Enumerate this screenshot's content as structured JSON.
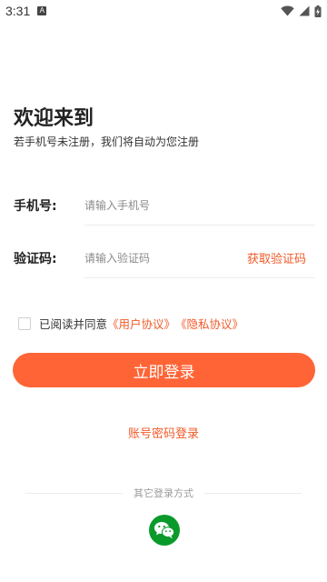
{
  "status_bar": {
    "time": "3:31",
    "notification_icon_text": "A",
    "icons": [
      "wifi-icon",
      "signal-icon",
      "battery-charging-icon"
    ]
  },
  "header": {
    "title": "欢迎来到",
    "subtitle": "若手机号未注册，我们将自动为您注册"
  },
  "form": {
    "phone": {
      "label": "手机号:",
      "placeholder": "请输入手机号",
      "value": ""
    },
    "code": {
      "label": "验证码:",
      "placeholder": "请输入验证码",
      "value": "",
      "get_code_label": "获取验证码"
    }
  },
  "agreement": {
    "checked": false,
    "prefix": "已阅读并同意",
    "user_agreement": "《用户协议》",
    "privacy_agreement": "《隐私协议》"
  },
  "login_button_label": "立即登录",
  "password_login_label": "账号密码登录",
  "other_login": {
    "label": "其它登录方式",
    "methods": [
      "wechat-icon"
    ]
  },
  "colors": {
    "accent": "#ff6436",
    "link": "#f05a28",
    "wechat": "#0a9a2c"
  }
}
